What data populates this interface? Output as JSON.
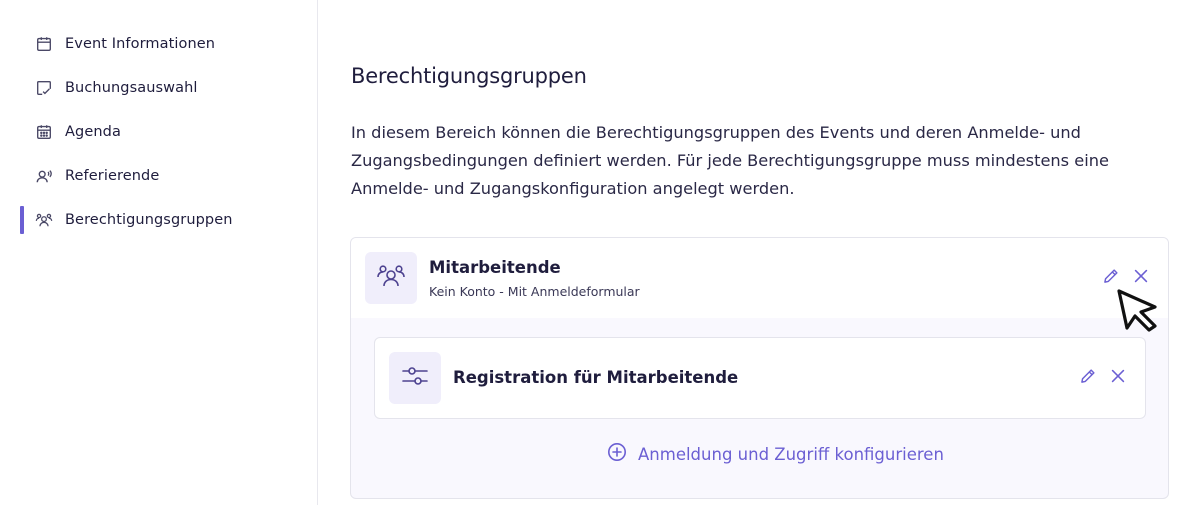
{
  "sidebar": {
    "items": [
      {
        "label": "Event Informationen",
        "icon": "calendar-icon",
        "active": false
      },
      {
        "label": "Buchungsauswahl",
        "icon": "booking-check-icon",
        "active": false
      },
      {
        "label": "Agenda",
        "icon": "agenda-calendar-icon",
        "active": false
      },
      {
        "label": "Referierende",
        "icon": "speaker-icon",
        "active": false
      },
      {
        "label": "Berechtigungsgruppen",
        "icon": "group-icon",
        "active": true
      }
    ]
  },
  "main": {
    "title": "Berechtigungsgruppen",
    "description": "In diesem Bereich können die Berechtigungsgruppen des Events und deren Anmelde- und Zugangsbedingungen definiert werden. Für jede Berechtigungsgruppe muss mindestens eine Anmelde- und Zugangskonfiguration angelegt werden.",
    "group": {
      "name": "Mitarbeitende",
      "subtitle": "Kein Konto - Mit Anmeldeformular",
      "config": {
        "name": "Registration für Mitarbeitende"
      },
      "add_label": "Anmeldung und Zugriff konfigurieren"
    }
  },
  "colors": {
    "accent": "#6b5fd3",
    "text": "#1f1d3d",
    "icon_bg": "#f0eefb"
  }
}
